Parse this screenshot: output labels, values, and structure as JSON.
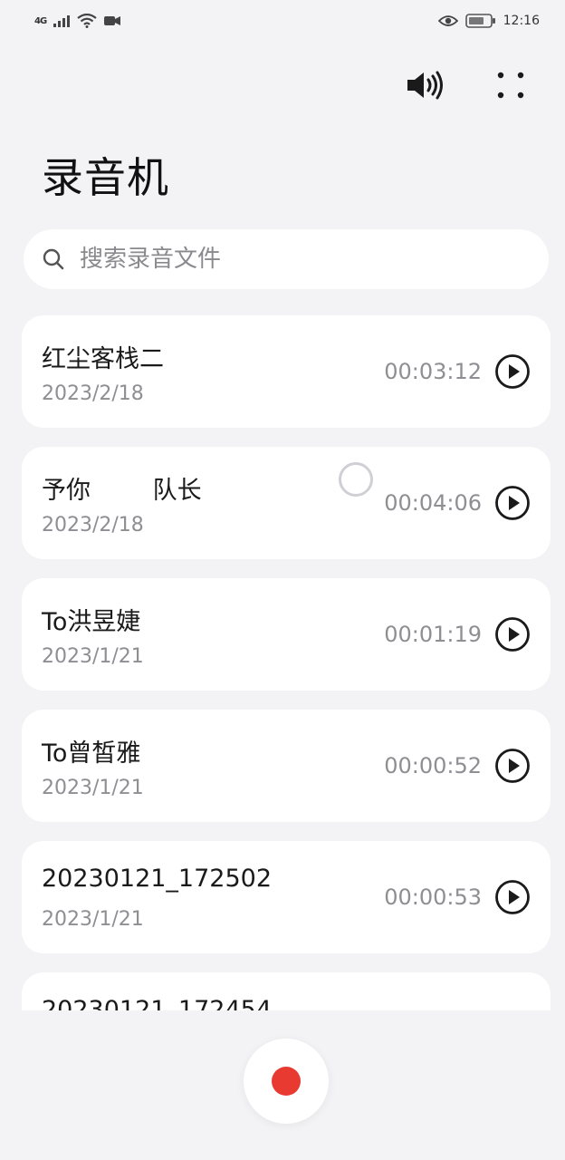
{
  "status_bar": {
    "signal": "4G",
    "time": "12:16",
    "icons": [
      "signal-icon",
      "wifi-icon",
      "video-icon",
      "eye-icon",
      "battery-icon"
    ]
  },
  "app_bar": {
    "icons": [
      "speaker-icon",
      "more-grid-icon"
    ]
  },
  "page": {
    "title": "录音机"
  },
  "search": {
    "placeholder": "搜索录音文件",
    "value": ""
  },
  "recordings": [
    {
      "name": "红尘客栈二",
      "date": "2023/2/18",
      "duration": "00:03:12"
    },
    {
      "name": "予你        队长",
      "date": "2023/2/18",
      "duration": "00:04:06"
    },
    {
      "name": "To洪昱婕",
      "date": "2023/1/21",
      "duration": "00:01:19"
    },
    {
      "name": "To曾皙雅",
      "date": "2023/1/21",
      "duration": "00:00:52"
    },
    {
      "name": "20230121_172502",
      "date": "2023/1/21",
      "duration": "00:00:53"
    },
    {
      "name": "20230121_172454",
      "date": "",
      "duration": ""
    }
  ],
  "colors": {
    "background": "#f3f3f5",
    "card": "#ffffff",
    "record_red": "#e83a30",
    "secondary_text": "#8e8e93"
  }
}
